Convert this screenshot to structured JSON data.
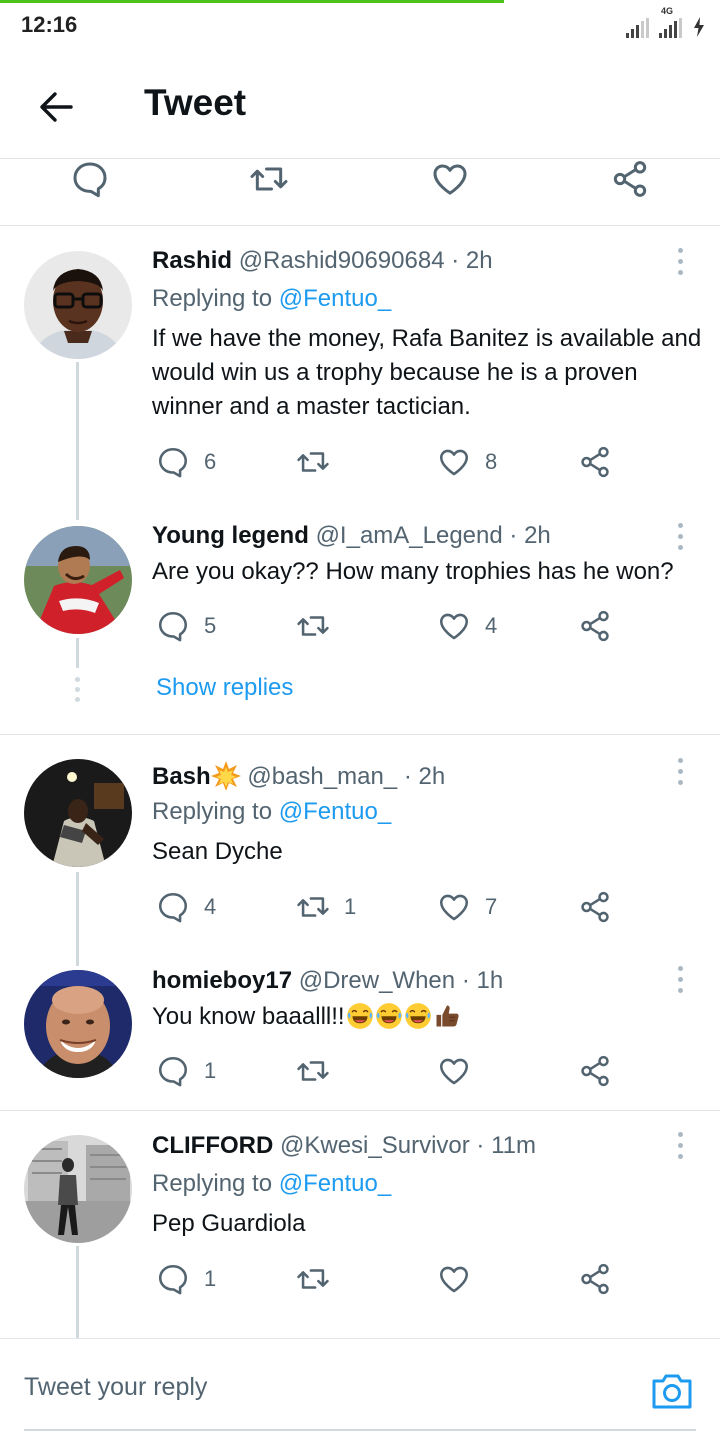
{
  "status_bar": {
    "time": "12:16",
    "network_label": "4G"
  },
  "header": {
    "title": "Tweet"
  },
  "main_actions": [
    "reply-icon",
    "retweet-icon",
    "like-icon",
    "share-icon"
  ],
  "replies": [
    {
      "name": "Rashid",
      "handle": "@Rashid90690684",
      "time": "· 2h",
      "replying_prefix": "Replying to",
      "replying_to": "@Fentuo_",
      "text": "If we have the money, Rafa Banitez is available and would win us a trophy because he is a proven winner and a master tactician.",
      "reply_count": "6",
      "retweet_count": "",
      "like_count": "8"
    },
    {
      "name": "Young legend",
      "handle": "@I_amA_Legend",
      "time": "· 2h",
      "text": "Are you okay?? How many trophies has he won?",
      "reply_count": "5",
      "retweet_count": "",
      "like_count": "4"
    },
    {
      "name": "Bash",
      "handle": "@bash_man_",
      "time": "· 2h",
      "replying_prefix": "Replying to",
      "replying_to": "@Fentuo_",
      "text": "Sean Dyche",
      "reply_count": "4",
      "retweet_count": "1",
      "like_count": "7"
    },
    {
      "name": "homieboy17",
      "handle": "@Drew_When",
      "time": "· 1h",
      "text": "You know baaalll!!",
      "reply_count": "1",
      "retweet_count": "",
      "like_count": ""
    },
    {
      "name": "CLIFFORD",
      "handle": "@Kwesi_Survivor",
      "time": "· 11m",
      "replying_prefix": "Replying to",
      "replying_to": "@Fentuo_",
      "text": "Pep Guardiola",
      "reply_count": "1",
      "retweet_count": "",
      "like_count": ""
    }
  ],
  "show_replies_label": "Show replies",
  "reply_bar": {
    "placeholder": "Tweet your reply"
  },
  "colors": {
    "accent": "#1d9bf0",
    "muted": "#536471",
    "load_bar": "#4cc21b"
  }
}
